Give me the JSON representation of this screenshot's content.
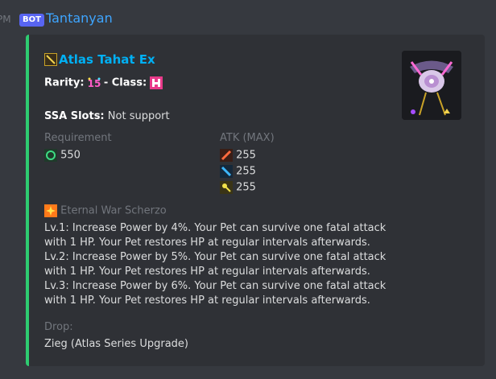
{
  "header": {
    "time_fragment": "PM",
    "bot_badge": "BOT",
    "username": "Tantanyan"
  },
  "embed": {
    "accent_color": "#2ecc71",
    "title": "Atlas Tahat Ex",
    "rarity_label": "Rarity:",
    "class_separator": "- Class:",
    "ssa_label": "SSA Slots:",
    "ssa_value": "Not support",
    "requirement_label": "Requirement",
    "requirement_value": "550",
    "atk_label": "ATK (MAX)",
    "atk_values": [
      "255",
      "255",
      "255"
    ],
    "skill_name": "Eternal War Scherzo",
    "skill_lines": [
      "Lv.1: Increase Power by 4%. Your Pet can survive one fatal attack",
      "with 1 HP. Your Pet restores HP at regular intervals afterwards.",
      "Lv.2: Increase Power by 5%. Your Pet can survive one fatal attack",
      "with 1 HP. Your Pet restores HP at regular intervals afterwards.",
      "Lv.3: Increase Power by 6%. Your Pet can survive one fatal attack",
      "with 1 HP. Your Pet restores HP at regular intervals afterwards."
    ],
    "drop_label": "Drop:",
    "drop_value": "Zieg (Atlas Series Upgrade)"
  },
  "icons": {
    "weapon": "staff-weapon-icon",
    "rarity": "rarity-15-icon",
    "class": "class-icon",
    "requirement": "requirement-icon",
    "atk_melee": "melee-atk-icon",
    "atk_ranged": "ranged-atk-icon",
    "atk_tech": "tech-atk-icon",
    "skill": "skill-icon",
    "thumbnail": "weapon-thumbnail"
  }
}
